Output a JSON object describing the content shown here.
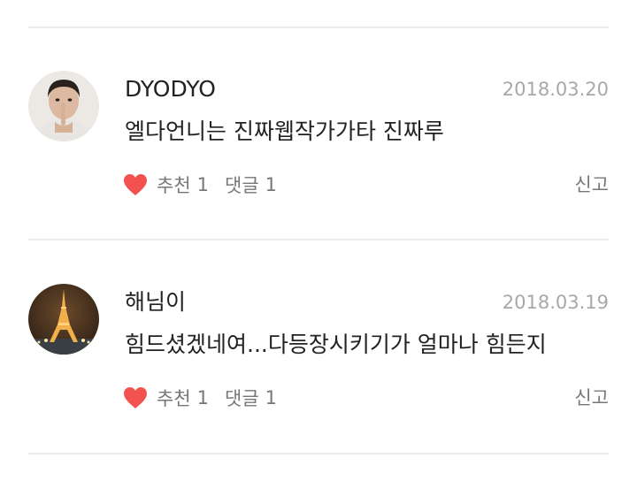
{
  "comments": [
    {
      "author": "DYODYO",
      "date": "2018.03.20",
      "text": "엘다언니는 진짜웹작가가타 진짜루",
      "like_label": "추천",
      "like_count": "1",
      "reply_label": "댓글",
      "reply_count": "1",
      "report_label": "신고",
      "avatar_icon": "person-shush-avatar"
    },
    {
      "author": "해님이",
      "date": "2018.03.19",
      "text": "힘드셨겠네여...다등장시키기가 얼마나 힘든지",
      "like_label": "추천",
      "like_count": "1",
      "reply_label": "댓글",
      "reply_count": "1",
      "report_label": "신고",
      "avatar_icon": "eiffel-tower-night-avatar"
    }
  ],
  "colors": {
    "heart": "#f2514f",
    "divider": "#ececec",
    "meta_text": "#a8a8a8",
    "action_text": "#777777"
  }
}
